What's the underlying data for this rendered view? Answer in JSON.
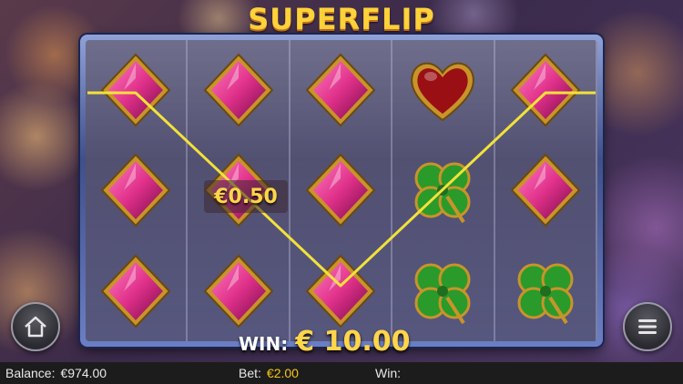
{
  "game": {
    "logo_text": "SUPERFLIP"
  },
  "reels": [
    [
      "diamond",
      "diamond",
      "diamond"
    ],
    [
      "diamond",
      "diamond",
      "diamond"
    ],
    [
      "diamond",
      "diamond",
      "diamond"
    ],
    [
      "heart",
      "clover",
      "clover"
    ],
    [
      "diamond",
      "diamond",
      "clover"
    ]
  ],
  "line_win": "€0.50",
  "win_display": {
    "label": "WIN:",
    "amount": "€ 10.00"
  },
  "status_bar": {
    "balance_label": "Balance:",
    "balance_value": "€974.00",
    "bet_label": "Bet:",
    "bet_value": "€2.00",
    "win_label": "Win:",
    "win_value": ""
  },
  "buttons": {
    "home_icon": "home-icon",
    "menu_icon": "menu-icon"
  },
  "colors": {
    "payline": "#f2e23a",
    "accent_gold": "#ffd54a",
    "diamond": "#e0318a",
    "heart": "#9a0f14",
    "clover": "#2a9a2a"
  }
}
